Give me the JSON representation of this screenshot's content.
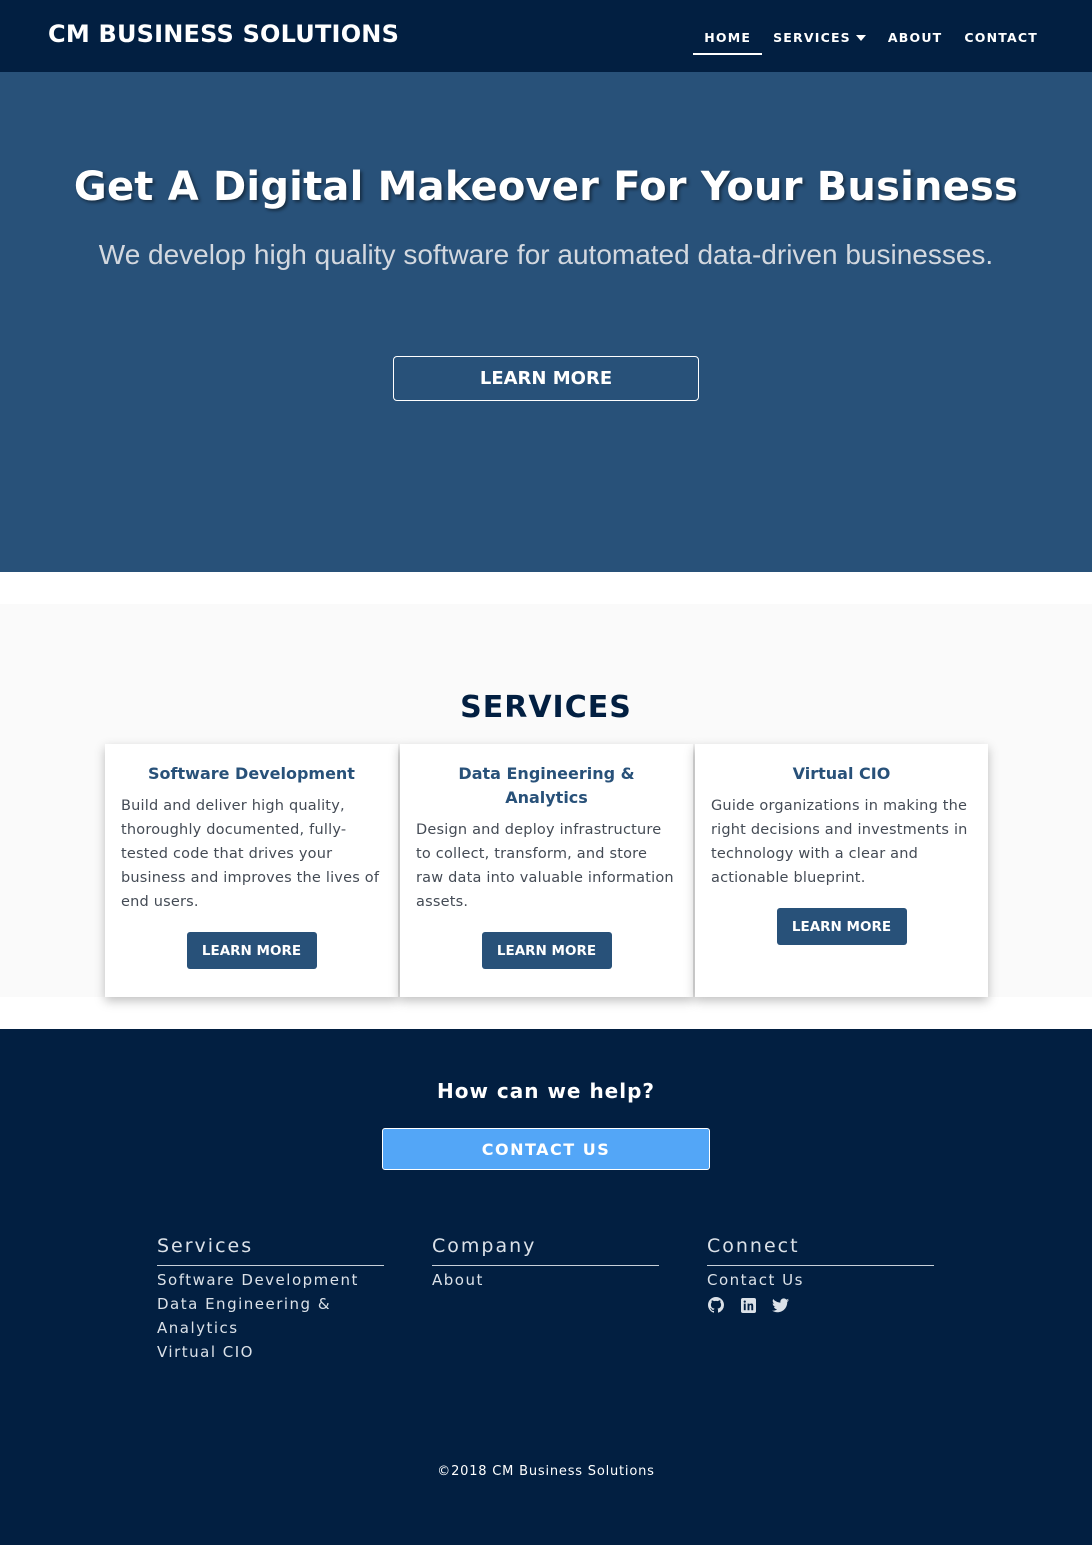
{
  "nav": {
    "brand": "CM BUSINESS SOLUTIONS",
    "links": [
      {
        "label": "HOME"
      },
      {
        "label": "SERVICES"
      },
      {
        "label": "ABOUT"
      },
      {
        "label": "CONTACT"
      }
    ]
  },
  "hero": {
    "title": "Get A Digital Makeover For Your Business",
    "subtitle": "We develop high quality software for automated data-driven businesses.",
    "button": "LEARN MORE"
  },
  "services": {
    "heading": "SERVICES",
    "cards": [
      {
        "title": "Software Development",
        "text": "Build and deliver high quality, thoroughly documented, fully-tested code that drives your business and improves the lives of end users.",
        "button": "LEARN MORE"
      },
      {
        "title": "Data Engineering & Analytics",
        "text": "Design and deploy infrastructure to collect, transform, and store raw data into valuable information assets.",
        "button": "LEARN MORE"
      },
      {
        "title": "Virtual CIO",
        "text": "Guide organizations in making the right decisions and investments in technology with a clear and actionable blueprint.",
        "button": "LEARN MORE"
      }
    ]
  },
  "footer": {
    "help": "How can we help?",
    "contact_button": "CONTACT US",
    "columns": [
      {
        "title": "Services",
        "links": [
          "Software Development",
          "Data Engineering & Analytics",
          "Virtual CIO"
        ]
      },
      {
        "title": "Company",
        "links": [
          "About"
        ]
      },
      {
        "title": "Connect",
        "links": [
          "Contact Us"
        ],
        "social": [
          "github-icon",
          "linkedin-icon",
          "twitter-icon"
        ]
      }
    ],
    "copyright": "©2018 CM Business Solutions"
  },
  "colors": {
    "nav_bg": "#021f41",
    "hero_bg": "#285179",
    "accent": "#285179",
    "contact_button": "#53a6f7",
    "services_bg": "#fafafa"
  }
}
